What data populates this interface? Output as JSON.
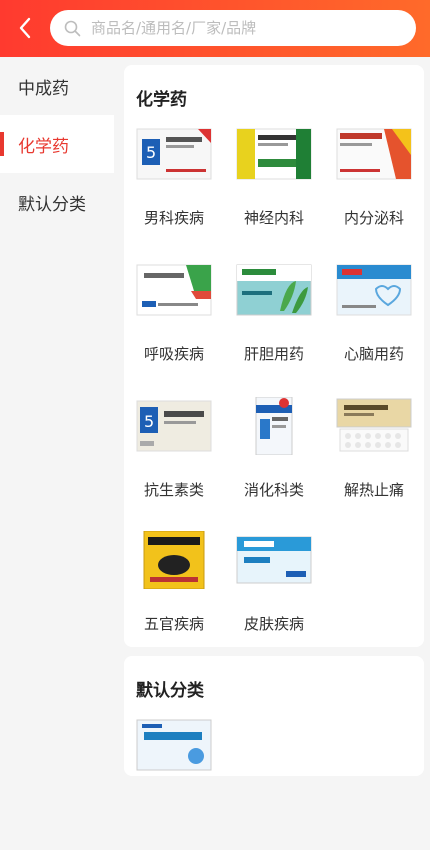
{
  "search": {
    "placeholder": "商品名/通用名/厂家/品牌"
  },
  "sidebar": {
    "items": [
      {
        "label": "中成药"
      },
      {
        "label": "化学药"
      },
      {
        "label": "默认分类"
      }
    ]
  },
  "sections": [
    {
      "title": "化学药",
      "items": [
        {
          "label": "男科疾病"
        },
        {
          "label": "神经内科"
        },
        {
          "label": "内分泌科"
        },
        {
          "label": "呼吸疾病"
        },
        {
          "label": "肝胆用药"
        },
        {
          "label": "心脑用药"
        },
        {
          "label": "抗生素类"
        },
        {
          "label": "消化科类"
        },
        {
          "label": "解热止痛"
        },
        {
          "label": "五官疾病"
        },
        {
          "label": "皮肤疾病"
        }
      ]
    },
    {
      "title": "默认分类"
    }
  ],
  "colors": {
    "accent": "#e8382f",
    "header_start": "#ff3a2f",
    "header_end": "#ff6a2a"
  },
  "icons": {
    "back": "chevron-left-icon",
    "search": "search-icon"
  }
}
